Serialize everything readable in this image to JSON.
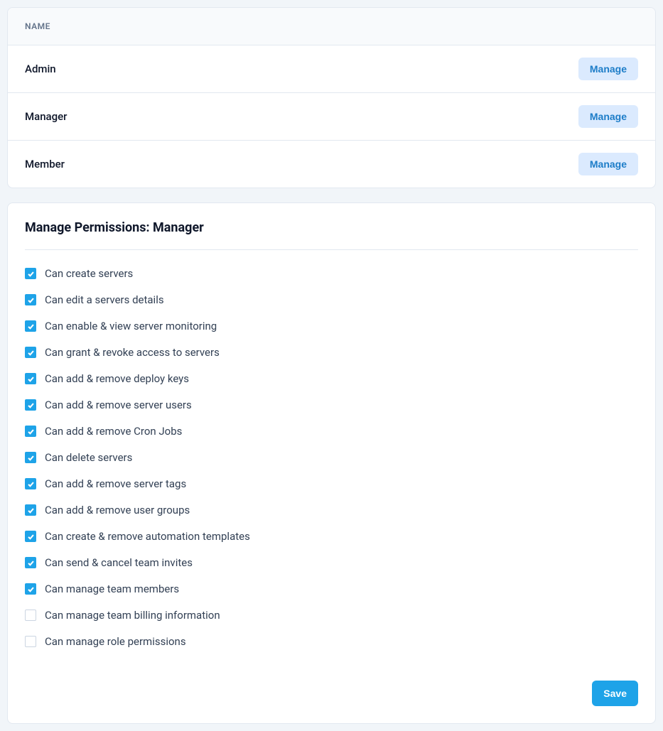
{
  "roles_table": {
    "header": "Name",
    "manage_label": "Manage",
    "rows": [
      {
        "name": "Admin"
      },
      {
        "name": "Manager"
      },
      {
        "name": "Member"
      }
    ]
  },
  "permissions_panel": {
    "title": "Manage Permissions: Manager",
    "save_label": "Save",
    "permissions": [
      {
        "label": "Can create servers",
        "checked": true
      },
      {
        "label": "Can edit a servers details",
        "checked": true
      },
      {
        "label": "Can enable & view server monitoring",
        "checked": true
      },
      {
        "label": "Can grant & revoke access to servers",
        "checked": true
      },
      {
        "label": "Can add & remove deploy keys",
        "checked": true
      },
      {
        "label": "Can add & remove server users",
        "checked": true
      },
      {
        "label": "Can add & remove Cron Jobs",
        "checked": true
      },
      {
        "label": "Can delete servers",
        "checked": true
      },
      {
        "label": "Can add & remove server tags",
        "checked": true
      },
      {
        "label": "Can add & remove user groups",
        "checked": true
      },
      {
        "label": "Can create & remove automation templates",
        "checked": true
      },
      {
        "label": "Can send & cancel team invites",
        "checked": true
      },
      {
        "label": "Can manage team members",
        "checked": true
      },
      {
        "label": "Can manage team billing information",
        "checked": false
      },
      {
        "label": "Can manage role permissions",
        "checked": false
      }
    ]
  }
}
